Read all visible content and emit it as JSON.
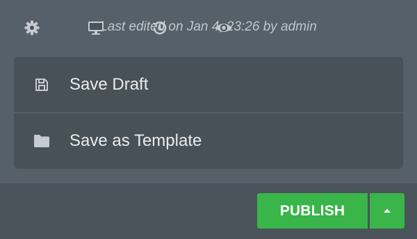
{
  "status": {
    "last_edited": "Last edited on Jan 4, 23:26 by admin"
  },
  "menu": {
    "items": [
      {
        "label": "Save Draft",
        "icon": "save-icon"
      },
      {
        "label": "Save as Template",
        "icon": "folder-icon"
      }
    ]
  },
  "footer": {
    "icons": [
      "settings-icon",
      "responsive-mode-icon",
      "history-icon",
      "preview-icon"
    ],
    "publish_label": "PUBLISH",
    "publish_menu_icon": "caret-up-icon"
  },
  "colors": {
    "background": "#556068",
    "panel": "#495158",
    "footer": "#4a535a",
    "publish": "#39b54a"
  }
}
